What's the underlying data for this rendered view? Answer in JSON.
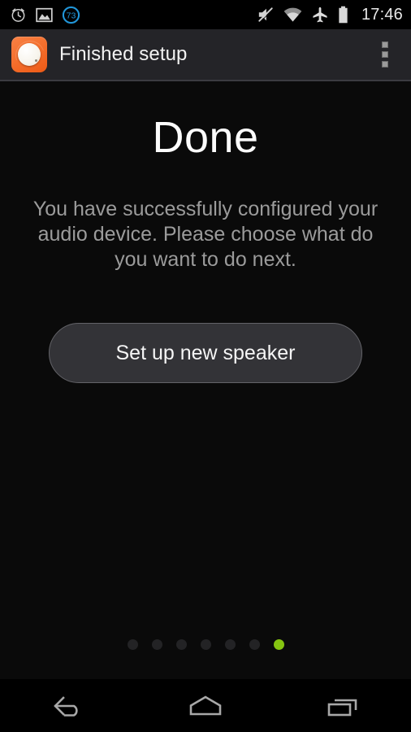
{
  "status_bar": {
    "left_icons": [
      {
        "name": "alarm-clock-icon",
        "label": "alarm"
      },
      {
        "name": "gallery-image-icon",
        "label": "screenshot"
      },
      {
        "name": "battery-percent-badge-icon",
        "label": "73"
      }
    ],
    "badge_value": "73",
    "right_icons": [
      {
        "name": "volume-muted-icon",
        "label": "silent"
      },
      {
        "name": "wifi-icon",
        "label": "wifi"
      },
      {
        "name": "airplane-mode-icon",
        "label": "airplane mode"
      },
      {
        "name": "battery-full-icon",
        "label": "battery"
      }
    ],
    "clock": "17:46",
    "badge_color": "#2196d9",
    "background": "#000000"
  },
  "action_bar": {
    "title": "Finished setup",
    "app_icon_name": "speaker-knob-app-icon",
    "overflow_name": "overflow-menu-icon",
    "background": "#242428",
    "accent": "#f4702e"
  },
  "main": {
    "headline": "Done",
    "body": "You have successfully configured your audio device. Please choose what do you want to do next.",
    "primary_button": "Set up new speaker",
    "background": "#0a0a0a"
  },
  "page_indicator": {
    "total": 7,
    "active_index": 6,
    "active_color": "#85c411",
    "inactive_color": "#232325"
  },
  "nav_bar": {
    "buttons": [
      {
        "name": "nav-back-button",
        "label": "Back"
      },
      {
        "name": "nav-home-button",
        "label": "Home"
      },
      {
        "name": "nav-recents-button",
        "label": "Recent apps"
      }
    ],
    "background": "#000000"
  }
}
